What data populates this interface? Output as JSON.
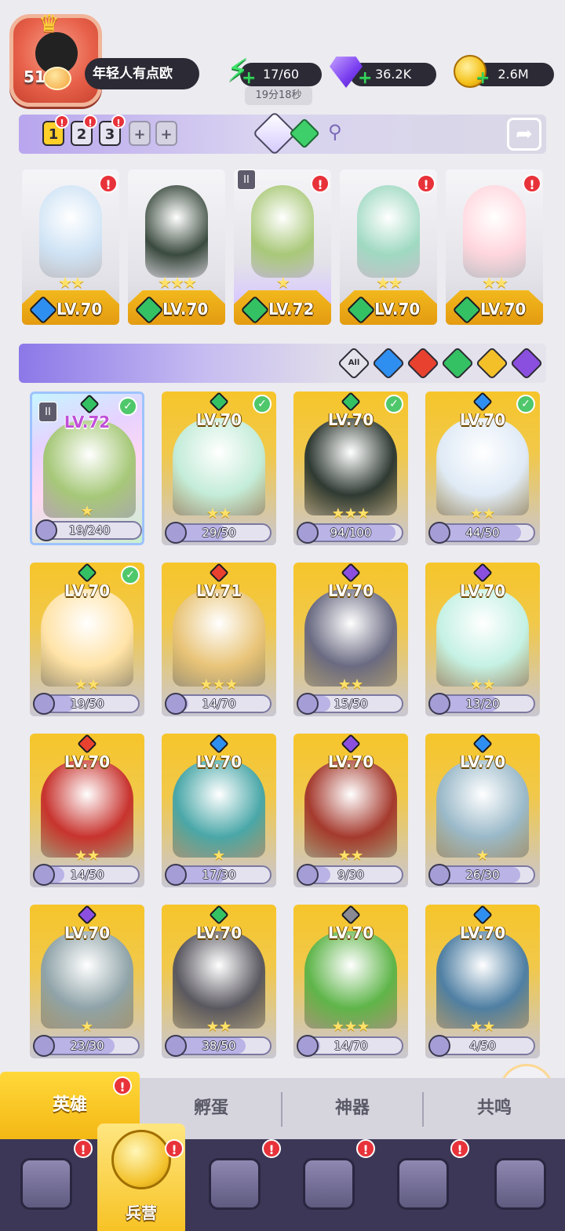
{
  "player": {
    "level": "51",
    "name": "年轻人有点欧"
  },
  "resources": {
    "energy": "17/60",
    "energy_timer": "19分18秒",
    "gems": "36.2K",
    "gold": "2.6M"
  },
  "team_slots": [
    {
      "label": "1",
      "active": true,
      "alert": "!"
    },
    {
      "label": "2",
      "active": false,
      "alert": "!"
    },
    {
      "label": "3",
      "active": false,
      "alert": "!"
    },
    {
      "label": "+",
      "active": false
    },
    {
      "label": "+",
      "active": false
    }
  ],
  "lineup": [
    {
      "level": "LV.70",
      "element": "water",
      "stars": "★★",
      "alert": "!",
      "art": "#cfe3f5"
    },
    {
      "level": "LV.70",
      "element": "wind",
      "stars": "★★★",
      "alert": "",
      "art": "#3a4a3e"
    },
    {
      "level": "LV.72",
      "element": "wind",
      "stars": "★",
      "alert": "!",
      "art": "#a9c878",
      "badge": "II"
    },
    {
      "level": "LV.70",
      "element": "wind",
      "stars": "★★",
      "alert": "!",
      "art": "#9fd9c2"
    },
    {
      "level": "LV.70",
      "element": "wind",
      "stars": "★★",
      "alert": "!",
      "art": "#ffd6dd"
    }
  ],
  "element_filters": {
    "all_label": "All"
  },
  "heroes": [
    {
      "level": "LV.72",
      "element": "wind",
      "fragments": "19/240",
      "fill": 0.08,
      "checked": true,
      "selected": true,
      "badge": "II",
      "stars": "★",
      "art": "#a6c878"
    },
    {
      "level": "LV.70",
      "element": "wind",
      "fragments": "29/50",
      "fill": 0.58,
      "checked": true,
      "stars": "★★",
      "art": "#c4ecd9"
    },
    {
      "level": "LV.70",
      "element": "wind",
      "fragments": "94/100",
      "fill": 0.94,
      "checked": true,
      "stars": "★★★",
      "art": "#2f3a33"
    },
    {
      "level": "LV.70",
      "element": "water",
      "fragments": "44/50",
      "fill": 0.88,
      "checked": true,
      "stars": "★★",
      "art": "#dfeaf6"
    },
    {
      "level": "LV.70",
      "element": "wind",
      "fragments": "19/50",
      "fill": 0.38,
      "checked": true,
      "stars": "★★",
      "art": "#ffe3a8"
    },
    {
      "level": "LV.71",
      "element": "fire",
      "fragments": "14/70",
      "fill": 0.2,
      "checked": false,
      "stars": "★★★",
      "art": "#e9c57a"
    },
    {
      "level": "LV.70",
      "element": "dark",
      "fragments": "15/50",
      "fill": 0.3,
      "checked": false,
      "stars": "★★",
      "art": "#6a6a82"
    },
    {
      "level": "LV.70",
      "element": "dark",
      "fragments": "13/20",
      "fill": 0.65,
      "checked": false,
      "stars": "★★",
      "art": "#c5f1e4"
    },
    {
      "level": "LV.70",
      "element": "fire",
      "fragments": "14/50",
      "fill": 0.28,
      "checked": false,
      "stars": "★★",
      "art": "#c8332e"
    },
    {
      "level": "LV.70",
      "element": "water",
      "fragments": "17/30",
      "fill": 0.57,
      "checked": false,
      "stars": "★",
      "art": "#4aa7a8"
    },
    {
      "level": "LV.70",
      "element": "dark",
      "fragments": "9/30",
      "fill": 0.3,
      "checked": false,
      "stars": "★★",
      "art": "#a53a2e"
    },
    {
      "level": "LV.70",
      "element": "water",
      "fragments": "26/30",
      "fill": 0.87,
      "checked": false,
      "stars": "★",
      "art": "#9ab9c9"
    },
    {
      "level": "LV.70",
      "element": "dark",
      "fragments": "23/30",
      "fill": 0.77,
      "checked": false,
      "stars": "★",
      "art": "#8fa3a8"
    },
    {
      "level": "LV.70",
      "element": "wind",
      "fragments": "38/50",
      "fill": 0.76,
      "checked": false,
      "stars": "★★",
      "art": "#5a5860"
    },
    {
      "level": "LV.70",
      "element": "all",
      "fragments": "14/70",
      "fill": 0.2,
      "checked": false,
      "stars": "★★★",
      "art": "#5fb54a"
    },
    {
      "level": "LV.70",
      "element": "water",
      "fragments": "4/50",
      "fill": 0.08,
      "checked": false,
      "stars": "★★",
      "art": "#4f7fa3"
    }
  ],
  "sub_tabs": [
    {
      "label": "英雄",
      "active": true,
      "alert": "!"
    },
    {
      "label": "孵蛋",
      "active": false
    },
    {
      "label": "神器",
      "active": false
    },
    {
      "label": "共鸣",
      "active": false
    }
  ],
  "bottom_nav": [
    {
      "name": "cards",
      "alert": "!"
    },
    {
      "name": "barracks",
      "label": "兵营",
      "active": true,
      "alert": "!"
    },
    {
      "name": "map",
      "alert": "!"
    },
    {
      "name": "castle",
      "alert": "!"
    },
    {
      "name": "mushroom",
      "alert": "!"
    },
    {
      "name": "banner",
      "alert": ""
    }
  ],
  "colors": {
    "water": "#2f8ff0",
    "fire": "#e8412f",
    "wind": "#34c164",
    "light": "#f4c02a",
    "dark": "#8b4fe0",
    "all": "#8a8a94"
  }
}
